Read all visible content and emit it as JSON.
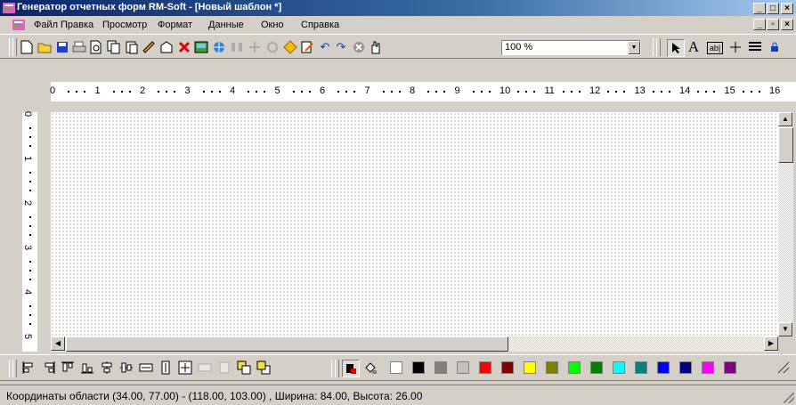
{
  "window": {
    "title": "Генератор отчетных форм RM-Soft - [Новый шаблон *]",
    "min_glyph": "_",
    "max_glyph": "□",
    "restore_glyph": "▫",
    "close_glyph": "×"
  },
  "menu": {
    "items": [
      "Файл",
      "Правка",
      "Просмотр",
      "Формат",
      "Данные",
      "Окно",
      "Справка"
    ]
  },
  "toolbar": {
    "zoom_value": "100 %",
    "text_tool_label": "A",
    "field_tool_label": "ab|"
  },
  "ruler": {
    "h_labels": [
      "0",
      "1",
      "2",
      "3",
      "4",
      "5",
      "6",
      "7",
      "8",
      "9",
      "10",
      "11",
      "12",
      "13",
      "14",
      "15",
      "16"
    ],
    "v_labels": [
      "0",
      "1",
      "2",
      "3",
      "4",
      "5"
    ]
  },
  "palette": {
    "colors": [
      "#ffffff",
      "#000000",
      "#808080",
      "#c0c0c0",
      "#ff0000",
      "#800000",
      "#ffff00",
      "#808000",
      "#00ff00",
      "#008000",
      "#00ffff",
      "#008080",
      "#0000ff",
      "#000080",
      "#ff00ff",
      "#800080"
    ]
  },
  "status": {
    "text": "Координаты области (34.00, 77.00) - (118.00, 103.00) , Ширина: 84.00, Высота: 26.00"
  }
}
